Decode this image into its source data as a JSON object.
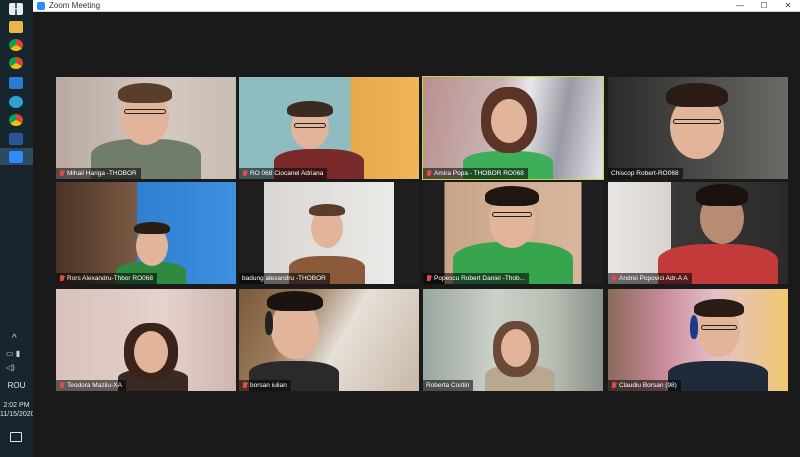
{
  "window": {
    "title": "Zoom Meeting",
    "min_label": "—",
    "max_label": "☐",
    "close_label": "✕"
  },
  "taskbar": {
    "language": "ROU",
    "time": "2:02 PM",
    "date": "11/15/2020",
    "chevron": "^"
  },
  "participants": [
    {
      "name": "Mihail Hariga -THOBOR",
      "muted": true,
      "active": false
    },
    {
      "name": "RO 068 Ciocanel Adriana",
      "muted": true,
      "active": false
    },
    {
      "name": "Amira Popa - THOBOR RO068",
      "muted": true,
      "active": true
    },
    {
      "name": "Chiscop Robert-RO068",
      "muted": false,
      "active": false
    },
    {
      "name": "Rors Alexandru-Thbor RO068",
      "muted": true,
      "active": false
    },
    {
      "name": "badung alexandru -THOBOR",
      "muted": false,
      "active": false
    },
    {
      "name": "Popescu Robert Daniel -Thob...",
      "muted": true,
      "active": false
    },
    {
      "name": "Andrei Popovici Adr-A A",
      "muted": true,
      "active": false
    },
    {
      "name": "Teodora Mazilu-XA",
      "muted": true,
      "active": false
    },
    {
      "name": "borsan iulian",
      "muted": true,
      "active": false
    },
    {
      "name": "Roberta Costin",
      "muted": false,
      "active": false
    },
    {
      "name": "Claudiu Borsan (98)",
      "muted": true,
      "active": false
    }
  ]
}
